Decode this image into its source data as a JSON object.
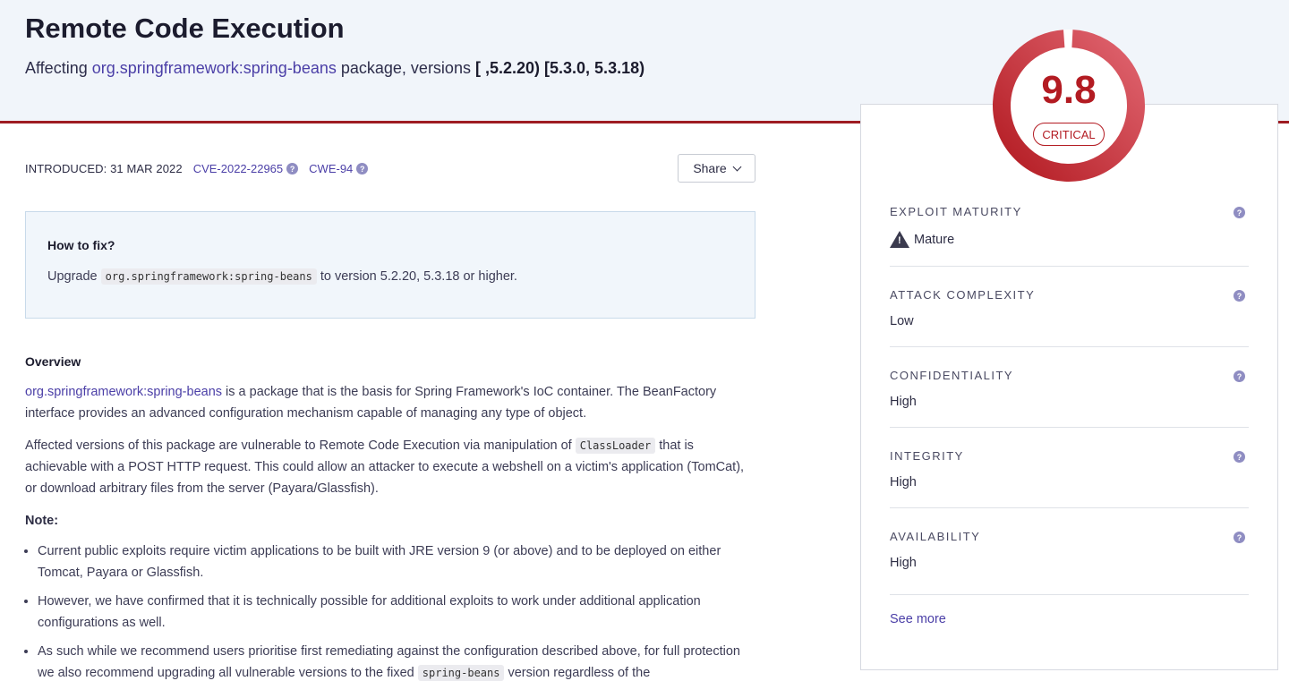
{
  "header": {
    "title": "Remote Code Execution",
    "affecting_prefix": "Affecting",
    "package_link": "org.springframework:spring-beans",
    "versions_prefix": "package, versions",
    "versions": "[ ,5.2.20) [5.3.0, 5.3.18)"
  },
  "meta": {
    "introduced": "INTRODUCED: 31 MAR 2022",
    "cve": "CVE-2022-22965",
    "cwe": "CWE-94",
    "help_glyph": "?"
  },
  "share": {
    "label": "Share"
  },
  "fix": {
    "heading": "How to fix?",
    "prefix": "Upgrade",
    "package_code": "org.springframework:spring-beans",
    "suffix": "to version 5.2.20, 5.3.18 or higher."
  },
  "overview": {
    "heading": "Overview",
    "p1_link": "org.springframework:spring-beans",
    "p1_text": " is a package that is the basis for Spring Framework's IoC container. The BeanFactory interface provides an advanced configuration mechanism capable of managing any type of object.",
    "p2_pre": "Affected versions of this package are vulnerable to Remote Code Execution via manipulation of ",
    "p2_code": "ClassLoader",
    "p2_post": " that is achievable with a POST HTTP request. This could allow an attacker to execute a webshell on a victim's application (TomCat), or download arbitrary files from the server (Payara/Glassfish).",
    "note": "Note:",
    "bullets": [
      "Current public exploits require victim applications to be built with JRE version 9 (or above) and to be deployed on either Tomcat, Payara or Glassfish.",
      "However, we have confirmed that it is technically possible for additional exploits to work under additional application configurations as well."
    ],
    "bullet3_pre": "As such while we recommend users prioritise first remediating against the configuration described above, for full protection we also recommend upgrading all vulnerable versions to the fixed ",
    "bullet3_code": "spring-beans",
    "bullet3_post": " version regardless of the"
  },
  "score": {
    "value": "9.8",
    "severity": "CRITICAL",
    "fraction": 0.98,
    "color": "#b31b22"
  },
  "metrics": [
    {
      "label": "EXPLOIT MATURITY",
      "value": "Mature",
      "icon": "warning-icon",
      "warn_glyph": "!"
    },
    {
      "label": "ATTACK COMPLEXITY",
      "value": "Low"
    },
    {
      "label": "CONFIDENTIALITY",
      "value": "High"
    },
    {
      "label": "INTEGRITY",
      "value": "High"
    },
    {
      "label": "AVAILABILITY",
      "value": "High"
    }
  ],
  "see_more": "See more"
}
